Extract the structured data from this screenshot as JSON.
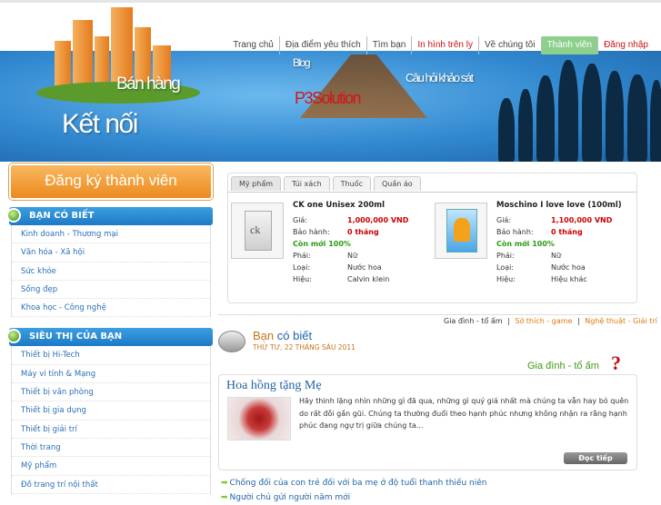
{
  "nav": {
    "items": [
      {
        "label": "Trang chủ",
        "style": ""
      },
      {
        "label": "Địa điểm yêu thích",
        "style": ""
      },
      {
        "label": "Tìm bạn",
        "style": ""
      },
      {
        "label": "In hình trên ly",
        "style": "red"
      },
      {
        "label": "Về chúng tôi",
        "style": ""
      },
      {
        "label": "Thành viên",
        "style": "active"
      },
      {
        "label": "Đăng nhập",
        "style": "red"
      }
    ]
  },
  "banner": {
    "w1": "Bán hàng",
    "w2": "Kết nối",
    "w3": "Blog",
    "w4": "P3Solution",
    "w5": "Câu hỏi khảo sát"
  },
  "sidebar": {
    "register_label": "Đăng ký thành viên",
    "section1_title": "BẠN CÓ BIẾT",
    "section1_items": [
      "Kinh doanh - Thương mại",
      "Văn hóa - Xã hội",
      "Sức khỏe",
      "Sống đẹp",
      "Khoa học - Công nghệ"
    ],
    "section2_title": "SIÊU THỊ CỦA BẠN",
    "section2_items": [
      "Thiết bị Hi-Tech",
      "Máy vi tính & Mạng",
      "Thiết bị văn phòng",
      "Thiết bị gia dụng",
      "Thiết bị giải trí",
      "Thời trang",
      "Mỹ phẩm",
      "Đồ trang trí nội thất"
    ]
  },
  "products": {
    "tabs": [
      "Mỹ phẩm",
      "Túi xách",
      "Thuốc",
      "Quần áo"
    ],
    "labels": {
      "price": "Giá:",
      "warranty": "Bảo hành:",
      "gender": "Phái:",
      "type": "Loại:",
      "brand": "Hiệu:"
    },
    "items": [
      {
        "name": "CK one Unisex 200ml",
        "price": "1,000,000 VND",
        "warranty": "0 tháng",
        "stock": "Còn mới 100%",
        "gender": "Nữ",
        "type": "Nước hoa",
        "brand": "Calvin klein",
        "img_text": "ck"
      },
      {
        "name": "Moschino I love love (100ml)",
        "price": "1,100,000 VND",
        "warranty": "0 tháng",
        "stock": "Còn mới 100%",
        "gender": "Nữ",
        "type": "Nước hoa",
        "brand": "Hiệu khác",
        "img_text": ""
      }
    ]
  },
  "categories": {
    "c1": "Gia đình - tổ ấm",
    "sep": "|",
    "c2": "Sở thích - game",
    "c3": "Nghệ thuật - Giải trí"
  },
  "news": {
    "title_part1": "Bạn",
    "title_part2": "có biết",
    "date": "THỨ TƯ, 22 THÁNG SÁU 2011",
    "section_title": "Gia đình - tổ ấm",
    "question_mark": "?",
    "article_title": "Hoa hồng tặng Mẹ",
    "article_text": "Hãy thinh lặng nhìn những gì đã qua, những gì quý giá nhất mà chúng ta vẫn hay bỏ quên do rất đỗi gần gũi. Chúng ta thường đuổi theo hạnh phúc nhưng không nhận ra rằng hạnh phúc đang ngự trị giữa chúng ta...",
    "read_more": "Đọc tiếp",
    "links": [
      "Chống đối của con trẻ đối với ba mẹ ở độ tuổi thanh thiếu niên",
      "Người chủ gửi người năm mới"
    ]
  }
}
